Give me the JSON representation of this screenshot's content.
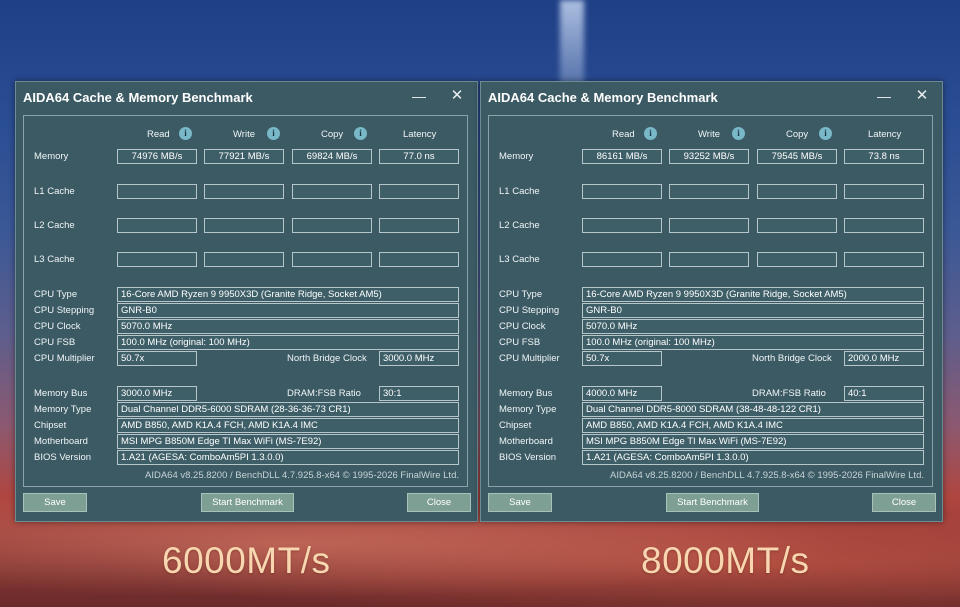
{
  "columns": {
    "read": "Read",
    "write": "Write",
    "copy": "Copy",
    "latency": "Latency"
  },
  "rows": {
    "memory": "Memory",
    "l1": "L1 Cache",
    "l2": "L2 Cache",
    "l3": "L3 Cache"
  },
  "labels": {
    "cpu_type": "CPU Type",
    "cpu_stepping": "CPU Stepping",
    "cpu_clock": "CPU Clock",
    "cpu_fsb": "CPU FSB",
    "cpu_multiplier": "CPU Multiplier",
    "north_bridge_clock": "North Bridge Clock",
    "memory_bus": "Memory Bus",
    "dram_fsb_ratio": "DRAM:FSB Ratio",
    "memory_type": "Memory Type",
    "chipset": "Chipset",
    "motherboard": "Motherboard",
    "bios_version": "BIOS Version"
  },
  "buttons": {
    "save": "Save",
    "start": "Start Benchmark",
    "close": "Close"
  },
  "icons": {
    "info": "info-icon",
    "minimize": "minimize-icon",
    "close": "close-icon"
  },
  "left": {
    "title": "AIDA64 Cache & Memory Benchmark",
    "memory": {
      "read": "74976 MB/s",
      "write": "77921 MB/s",
      "copy": "69824 MB/s",
      "latency": "77.0 ns"
    },
    "cpu_type": "16-Core AMD Ryzen 9 9950X3D  (Granite Ridge, Socket AM5)",
    "cpu_stepping": "GNR-B0",
    "cpu_clock": "5070.0 MHz",
    "cpu_fsb": "100.0 MHz  (original: 100 MHz)",
    "cpu_multiplier": "50.7x",
    "north_bridge_clock": "3000.0 MHz",
    "memory_bus": "3000.0 MHz",
    "dram_fsb_ratio": "30:1",
    "memory_type": "Dual Channel DDR5-6000 SDRAM  (28-36-36-73 CR1)",
    "chipset": "AMD B850, AMD K1A.4 FCH, AMD K1A.4 IMC",
    "motherboard": "MSI MPG B850M Edge TI Max WiFi (MS-7E92)",
    "bios_version": "1.A21  (AGESA: ComboAm5PI 1.3.0.0)",
    "footer": "AIDA64 v8.25.8200 / BenchDLL 4.7.925.8-x64  © 1995-2026 FinalWire Ltd.",
    "caption": "6000MT/s"
  },
  "right": {
    "title": "AIDA64 Cache & Memory Benchmark",
    "memory": {
      "read": "86161 MB/s",
      "write": "93252 MB/s",
      "copy": "79545 MB/s",
      "latency": "73.8 ns"
    },
    "cpu_type": "16-Core AMD Ryzen 9 9950X3D  (Granite Ridge, Socket AM5)",
    "cpu_stepping": "GNR-B0",
    "cpu_clock": "5070.0 MHz",
    "cpu_fsb": "100.0 MHz  (original: 100 MHz)",
    "cpu_multiplier": "50.7x",
    "north_bridge_clock": "2000.0 MHz",
    "memory_bus": "4000.0 MHz",
    "dram_fsb_ratio": "40:1",
    "memory_type": "Dual Channel DDR5-8000 SDRAM  (38-48-48-122 CR1)",
    "chipset": "AMD B850, AMD K1A.4 FCH, AMD K1A.4 IMC",
    "motherboard": "MSI MPG B850M Edge TI Max WiFi (MS-7E92)",
    "bios_version": "1.A21  (AGESA: ComboAm5PI 1.3.0.0)",
    "footer": "AIDA64 v8.25.8200 / BenchDLL 4.7.925.8-x64  © 1995-2026 FinalWire Ltd.",
    "caption": "8000MT/s"
  }
}
